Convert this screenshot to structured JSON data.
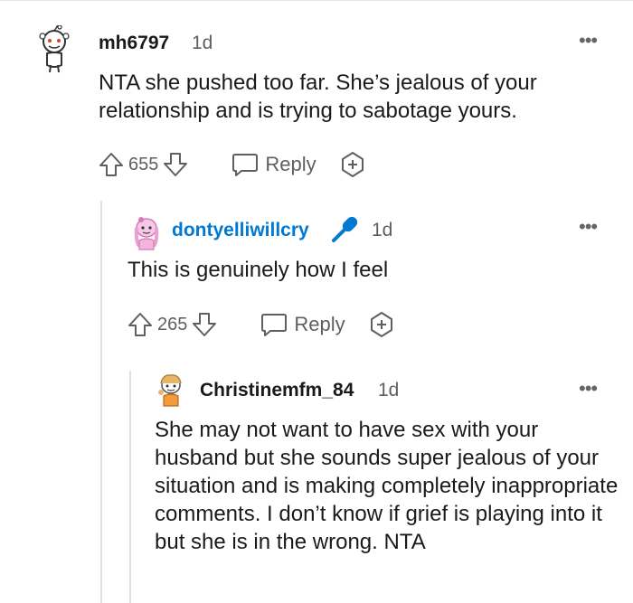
{
  "comments": [
    {
      "username": "mh6797",
      "age": "1d",
      "body": "NTA she pushed too far. She’s jealous of your relationship and is trying to sabotage yours.",
      "votes": "655",
      "reply_label": "Reply",
      "username_color": "#1a1a1b"
    },
    {
      "username": "dontyelliwillcry",
      "age": "1d",
      "body": "This is genuinely how I feel",
      "votes": "265",
      "reply_label": "Reply",
      "username_color": "#0079d3",
      "badge_icon": "microphone-icon"
    },
    {
      "username": "Christinemfm_84",
      "age": "1d",
      "body": "She may not want to have sex with your husband but she sounds super jealous of your situation and is making completely inappropriate comments. I don’t know if grief is playing into it but she is in the wrong. NTA",
      "username_color": "#1a1a1b"
    }
  ],
  "colors": {
    "accent": "#0079d3",
    "muted": "#5f5f5f",
    "thread_line": "#e0e0e0"
  }
}
